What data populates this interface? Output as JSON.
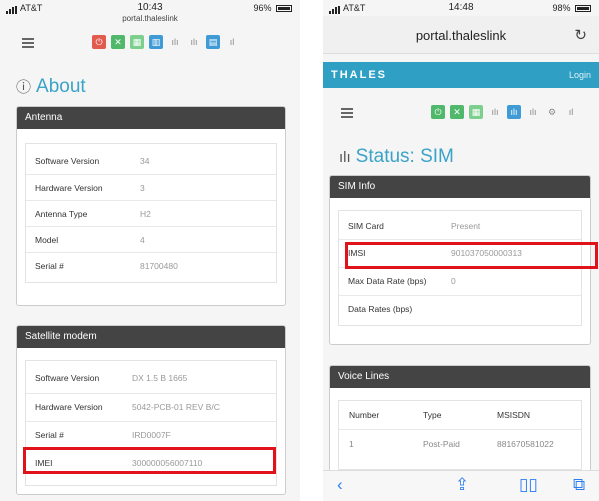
{
  "left": {
    "status": {
      "carrier": "AT&T",
      "time": "10:43",
      "battery": "96%",
      "battery_level": 0.96
    },
    "url": "portal.thaleslink",
    "heading": "About",
    "antenna_panel": {
      "title": "Antenna",
      "rows": [
        {
          "label": "Software Version",
          "value": "34"
        },
        {
          "label": "Hardware Version",
          "value": "3"
        },
        {
          "label": "Antenna Type",
          "value": "H2"
        },
        {
          "label": "Model",
          "value": "4"
        },
        {
          "label": "Serial #",
          "value": "81700480"
        }
      ]
    },
    "modem_panel": {
      "title": "Satellite modem",
      "rows": [
        {
          "label": "Software Version",
          "value": "DX 1.5 B 1665"
        },
        {
          "label": "Hardware Version",
          "value": "5042-PCB-01 REV B/C"
        },
        {
          "label": "Serial #",
          "value": "IRD0007F"
        },
        {
          "label": "IMEI",
          "value": "300000056007110"
        }
      ]
    }
  },
  "right": {
    "status": {
      "carrier": "AT&T",
      "time": "14:48",
      "battery": "98%",
      "battery_level": 0.98
    },
    "url": "portal.thaleslink",
    "brand": "THALES",
    "login": "Login",
    "heading": "Status: SIM",
    "sim_panel": {
      "title": "SIM Info",
      "rows": [
        {
          "label": "SIM Card",
          "value": "Present"
        },
        {
          "label": "IMSI",
          "value": "901037050000313"
        },
        {
          "label": "Max Data Rate (bps)",
          "value": "0"
        },
        {
          "label": "Data Rates (bps)",
          "value": ""
        }
      ]
    },
    "voice_panel": {
      "title": "Voice Lines",
      "columns": [
        "Number",
        "Type",
        "MSISDN"
      ],
      "rows": [
        {
          "number": "1",
          "type": "Post-Paid",
          "msisdn": "881670581022"
        }
      ]
    }
  },
  "colors": {
    "accent": "#3aa3c7",
    "brand_bar": "#2fa0c4",
    "highlight": "#e0121a",
    "panel_header": "#444444"
  },
  "icons": [
    "power-icon",
    "link-icon",
    "signal-icon",
    "chart-icon",
    "antenna-icon",
    "settings-icon",
    "share-icon",
    "bookmarks-icon",
    "tabs-icon",
    "back-icon",
    "reload-icon"
  ]
}
